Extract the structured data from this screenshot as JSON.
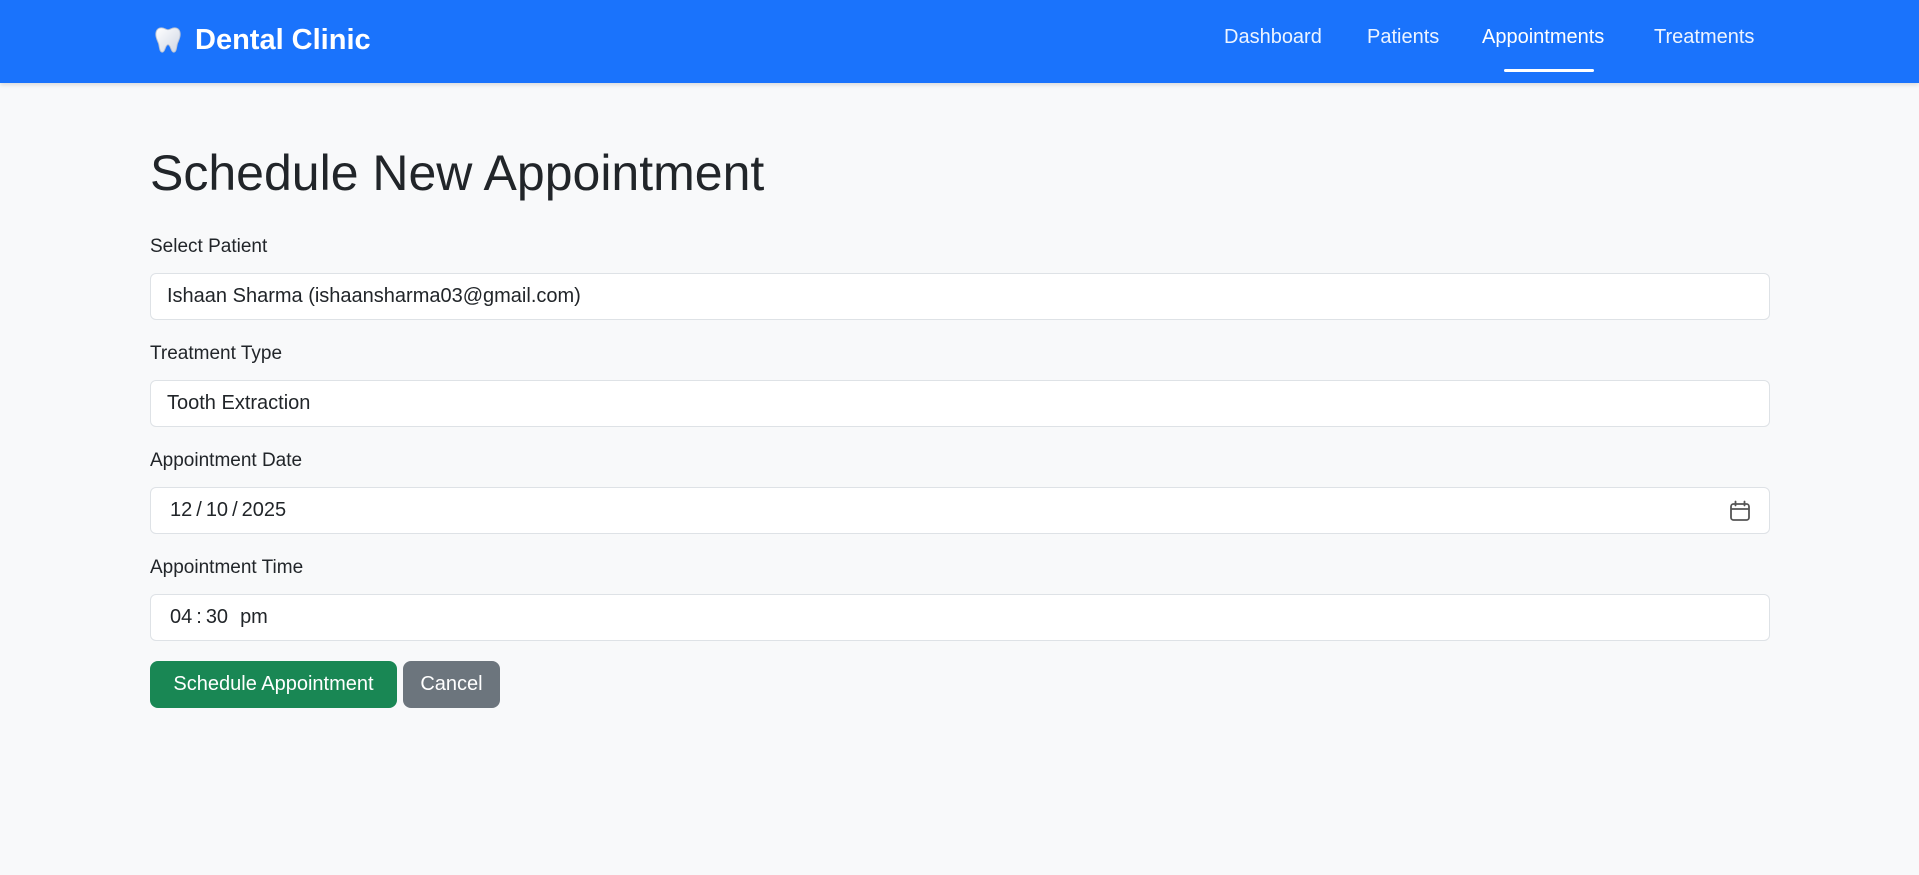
{
  "brand": {
    "icon": "tooth-icon",
    "title": "Dental Clinic"
  },
  "nav": {
    "items": [
      {
        "label": "Dashboard",
        "active": false
      },
      {
        "label": "Patients",
        "active": false
      },
      {
        "label": "Appointments",
        "active": true
      },
      {
        "label": "Treatments",
        "active": false
      }
    ]
  },
  "page": {
    "title": "Schedule New Appointment"
  },
  "form": {
    "patient": {
      "label": "Select Patient",
      "value": "Ishaan Sharma (ishaansharma03@gmail.com)"
    },
    "treatment": {
      "label": "Treatment Type",
      "value": "Tooth Extraction"
    },
    "date": {
      "label": "Appointment Date",
      "month": "12",
      "day": "10",
      "year": "2025",
      "separator": "/"
    },
    "time": {
      "label": "Appointment Time",
      "hour": "04",
      "minute": "30",
      "period": "pm",
      "separator": ":"
    },
    "submit_label": "Schedule Appointment",
    "cancel_label": "Cancel"
  },
  "colors": {
    "navbar": "#1a73fc",
    "primary_button": "#198754",
    "secondary_button": "#6c757d",
    "page_background": "#f8f9fa"
  }
}
